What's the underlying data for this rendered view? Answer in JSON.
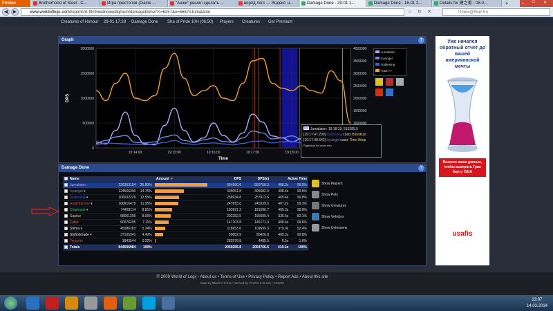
{
  "browser": {
    "firefox_label": "Firefox",
    "tabs": [
      {
        "label": "Brotherhood of Steel - C...",
        "active": false
      },
      {
        "label": "Игра престолов (Game ...",
        "active": false
      },
      {
        "label": "\"Анжи\" решил сделать ...",
        "active": false
      },
      {
        "label": "ворлд логс — Яндекс: н...",
        "active": false
      },
      {
        "label": "Damage Done - 29-01 1...",
        "active": true
      },
      {
        "label": "Damage Done - 16-01 2...",
        "active": false
      },
      {
        "label": "Details for 健之羹 - 08-0...",
        "active": false
      }
    ],
    "url_host": "www.worldoflogs.com",
    "url_path": "/reports/rt-f9c9owdnoieodlq/sum/damageDone/?s=6257&e=6667#Jumalaton",
    "search_placeholder": "Поиск@Mail.Ru"
  },
  "sitebar": {
    "links": [
      "Creatures of Honour",
      "29-01 17:28",
      "Damage Done",
      "Sha of Pride 10H (06:50)",
      "Players",
      "Creatures",
      "Get Premium"
    ]
  },
  "graph": {
    "title": "Graph",
    "help": "?",
    "tooltip": {
      "header": "Jumalaton: 19:18:19, 515385.5",
      "line1_time": "[19:17:47.200]",
      "line1_who": "Gulkening",
      "line1_mid": "casts",
      "line1_spell": "Bloodlust",
      "line2_time": "[19:17:48.642]",
      "line2_who": "Icyangel",
      "line2_mid": "casts",
      "line2_spell": "Time Warp",
      "hint": "Rightclick for more info"
    }
  },
  "chart_data": {
    "type": "line",
    "xlabel": "Time",
    "ylabel": "DPS",
    "x_ticks": [
      "19:14:00",
      "19:15:00",
      "19:16:00",
      "19:17:00",
      "19:18:00"
    ],
    "y_ticks_left": [
      "0",
      "500000",
      "1000000",
      "1500000",
      "2000000"
    ],
    "y_ticks_right": [
      "0",
      "500000",
      "1000000",
      "1500000",
      "2000000",
      "2500000",
      "3000000",
      "3500000",
      "4000000"
    ],
    "ylim_left": [
      0,
      2000000
    ],
    "ylim_right": [
      0,
      4000000
    ],
    "x_range_minutes": [
      -1.0,
      5.5
    ],
    "highlight_range": [
      3.75,
      4.15
    ],
    "markers": [
      3.05,
      3.15,
      3.7,
      4.2,
      5.3
    ],
    "legend": [
      "Jumalaton",
      "Icyangel",
      "Gulkening",
      "Total >>"
    ],
    "series": [
      {
        "name": "Jumalaton",
        "color": "#b8a6ff",
        "x": [
          -1.0,
          -0.75,
          -0.5,
          -0.25,
          0,
          0.25,
          0.5,
          0.75,
          1.0,
          1.25,
          1.5,
          1.75,
          2.0,
          2.25,
          2.5,
          2.75,
          3.0,
          3.25,
          3.5,
          3.75,
          4.0,
          4.25,
          4.5,
          4.75,
          5.0,
          5.25,
          5.5
        ],
        "values": [
          120000,
          80000,
          350000,
          720000,
          250000,
          80000,
          60000,
          450000,
          800000,
          350000,
          120000,
          200000,
          500000,
          250000,
          120000,
          300000,
          680000,
          520000,
          240000,
          200000,
          120000,
          180000,
          150000,
          140000,
          300000,
          250000,
          20000
        ]
      },
      {
        "name": "Icyangel",
        "color": "#6c8ee0",
        "x": [
          -1.0,
          -0.75,
          -0.5,
          -0.25,
          0,
          0.25,
          0.5,
          0.75,
          1.0,
          1.25,
          1.5,
          1.75,
          2.0,
          2.25,
          2.5,
          2.75,
          3.0,
          3.25,
          3.5,
          3.75,
          4.0,
          4.25,
          4.5,
          4.75,
          5.0,
          5.25,
          5.5
        ],
        "values": [
          90000,
          150000,
          220000,
          250000,
          110000,
          100000,
          120000,
          220000,
          260000,
          150000,
          110000,
          160000,
          200000,
          130000,
          110000,
          200000,
          340000,
          300000,
          180000,
          200000,
          240000,
          180000,
          120000,
          150000,
          220000,
          160000,
          20000
        ]
      },
      {
        "name": "Gulkening",
        "color": "#3b5ed8",
        "x": [
          -1.0,
          -0.75,
          -0.5,
          -0.25,
          0,
          0.25,
          0.5,
          0.75,
          1.0,
          1.25,
          1.5,
          1.75,
          2.0,
          2.25,
          2.5,
          2.75,
          3.0,
          3.25,
          3.5,
          3.75,
          4.0,
          4.25,
          4.5,
          4.75,
          5.0,
          5.25,
          5.5
        ],
        "values": [
          60000,
          100000,
          90000,
          80000,
          70000,
          60000,
          80000,
          110000,
          150000,
          90000,
          70000,
          90000,
          100000,
          80000,
          60000,
          90000,
          130000,
          140000,
          100000,
          120000,
          130000,
          100000,
          80000,
          90000,
          120000,
          90000,
          10000
        ]
      },
      {
        "name": "Total",
        "color": "#f0a030",
        "axis": "right",
        "x": [
          -1.0,
          -0.75,
          -0.5,
          -0.25,
          0,
          0.25,
          0.5,
          0.75,
          1.0,
          1.25,
          1.5,
          1.75,
          2.0,
          2.25,
          2.5,
          2.75,
          3.0,
          3.25,
          3.5,
          3.75,
          4.0,
          4.25,
          4.5,
          4.75,
          5.0,
          5.25,
          5.5
        ],
        "values": [
          2300000,
          1900000,
          2600000,
          3000000,
          2000000,
          1900000,
          2100000,
          3200000,
          3800000,
          2800000,
          2100000,
          2300000,
          2500000,
          2000000,
          1900000,
          2600000,
          3500000,
          3600000,
          2600000,
          2400000,
          2300000,
          2500000,
          2300000,
          2200000,
          3100000,
          2700000,
          1000000
        ]
      }
    ]
  },
  "damage": {
    "title": "Damage Done",
    "help": "?",
    "headers": {
      "name": "Name",
      "amount": "Amount",
      "dps": "DPS",
      "dpse": "DPS(e)",
      "active": "Active Time"
    },
    "rows": [
      {
        "name": "Jumalaton",
        "color": "#b8a6ff",
        "amount": "226363104",
        "pct": "26.80%",
        "bar": 1.0,
        "dps": "554560.6",
        "dpse": "550758.3",
        "active": "408.2s",
        "active_pct": "99.5%",
        "selected": true,
        "caret": false
      },
      {
        "name": "Icyangel",
        "color": "#6c8ee0",
        "amount": "124566390",
        "pct": "14.75%",
        "bar": 0.55,
        "dps": "305051.8",
        "dpse": "305082.0",
        "active": "408.4s",
        "active_pct": "99.6%",
        "selected": false,
        "caret": true
      },
      {
        "name": "Gulkening",
        "color": "#3b5ed8",
        "amount": "106002229",
        "pct": "12.55%",
        "bar": 0.47,
        "dps": "258934.8",
        "dpse": "257913.6",
        "active": "409.4s",
        "active_pct": "99.8%",
        "selected": false,
        "caret": true
      },
      {
        "name": "Angleblacker",
        "color": "#e04040",
        "amount": "100916479",
        "pct": "11.95%",
        "bar": 0.445,
        "dps": "247815.0",
        "dpse": "245539.5",
        "active": "407.2s",
        "active_pct": "99.3%",
        "selected": false,
        "caret": true
      },
      {
        "name": "Chipmank",
        "color": "#2ad080",
        "amount": "74428114",
        "pct": "8.81%",
        "bar": 0.33,
        "dps": "183621.2",
        "dpse": "181090.7",
        "active": "405.3s",
        "active_pct": "98.8%",
        "selected": false,
        "caret": true
      },
      {
        "name": "Saphar",
        "color": "#f0c060",
        "amount": "68061205",
        "pct": "8.06%",
        "bar": 0.3,
        "dps": "202252.5",
        "dpse": "165599.4",
        "active": "336.5s",
        "active_pct": "82.1%",
        "selected": false,
        "caret": false
      },
      {
        "name": "Cylke",
        "color": "#f07850",
        "amount": "60076295",
        "pct": "7.11%",
        "bar": 0.265,
        "dps": "147103.8",
        "dpse": "146171.4",
        "active": "408.4s",
        "active_pct": "99.6%",
        "selected": false,
        "caret": false
      },
      {
        "name": "Shima",
        "color": "#e8e8e8",
        "amount": "45086283",
        "pct": "5.34%",
        "bar": 0.2,
        "dps": "118953.6",
        "dpse": "109699.3",
        "active": "379.0s",
        "active_pct": "92.4%",
        "selected": false,
        "caret": true
      },
      {
        "name": "Shiftofshade",
        "color": "#e8e8e8",
        "amount": "37165341",
        "pct": "4.40%",
        "bar": 0.165,
        "dps": "90802.9",
        "dpse": "90426.8",
        "active": "409.3s",
        "active_pct": "99.8%",
        "selected": false,
        "caret": true
      },
      {
        "name": "Tengster",
        "color": "#e04040",
        "amount": "1843544",
        "pct": "0.22%",
        "bar": 0.01,
        "dps": "282578.8",
        "dpse": "4485.5",
        "active": "6.5s",
        "active_pct": "1.6%",
        "selected": false,
        "caret": false
      }
    ],
    "total": {
      "name": "Totals",
      "amount": "844506984",
      "pct": "100%",
      "dps": "2050255.8",
      "dpse": "2054766.5",
      "active": "410.1s",
      "active_pct": "100%"
    },
    "options": [
      "Show Players",
      "Show Pets",
      "Show Creatures",
      "Show Vehicles",
      "Show Unknowns"
    ]
  },
  "footer": {
    "line1": "© 2009 World of Logs - About us • Terms of Use • Privacy Policy • Report Ads • About this site",
    "line2": "Data by Black in 0.01s • Served by FirePie in 0.13s • v31200"
  },
  "ad": {
    "text": "Уже начался обратный отчёт до вашей американской мечты",
    "cta": "Внесите ваши данные, чтобы выиграть Грин Карту США",
    "brand": "usafis"
  },
  "taskbar": {
    "time": "23:07",
    "date": "14.03.2014"
  },
  "colors": {
    "accent": "#2b4a8c",
    "total": "#f0a030"
  }
}
